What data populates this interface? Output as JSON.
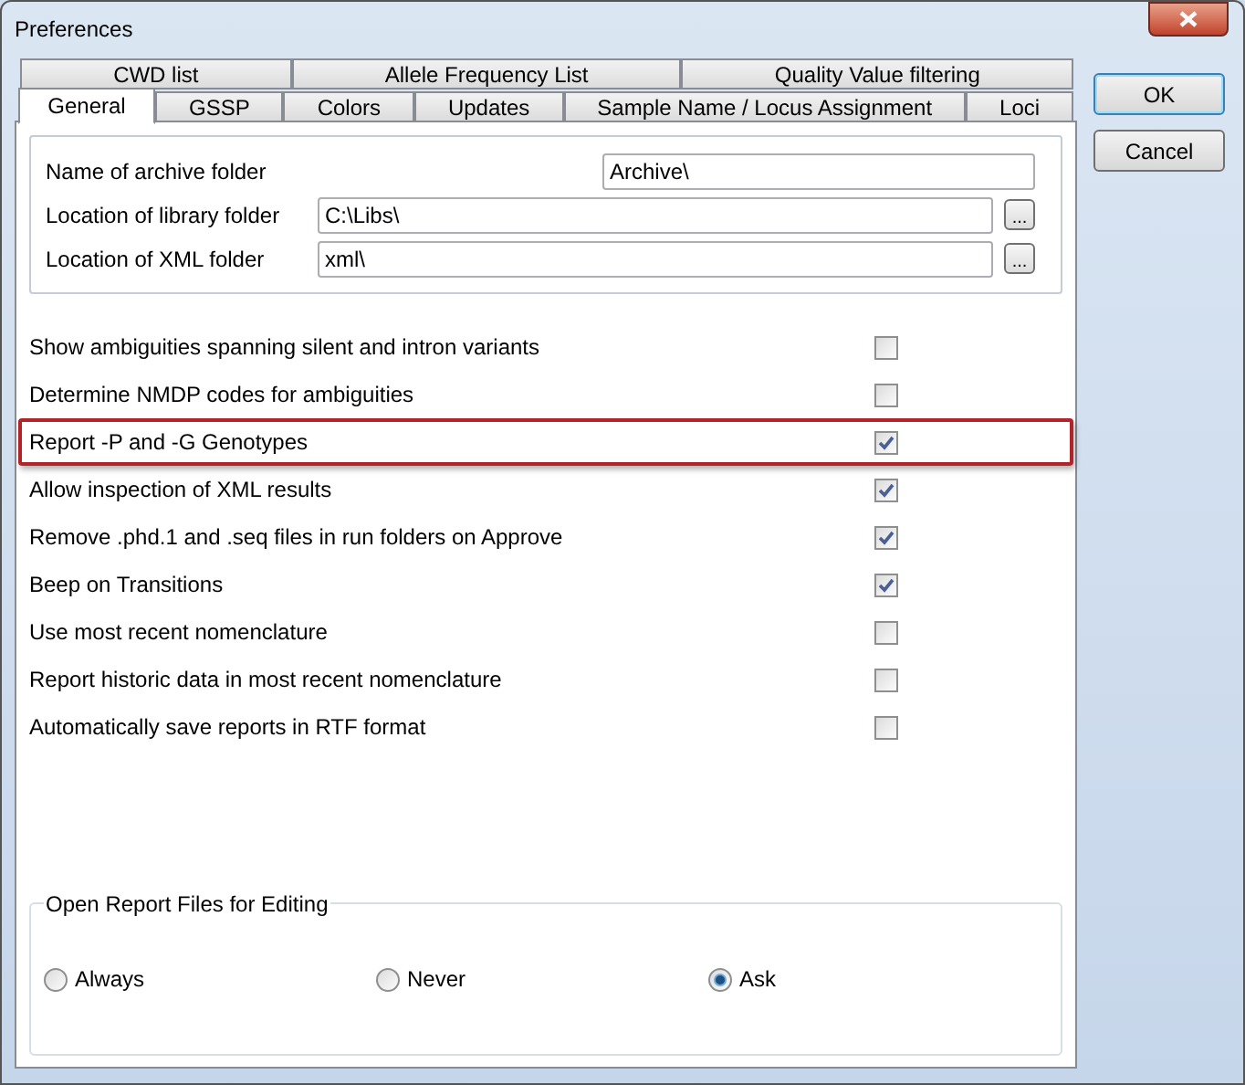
{
  "window": {
    "title": "Preferences"
  },
  "tab_rows": [
    [
      {
        "label": "CWD list",
        "selected": false
      },
      {
        "label": "Allele Frequency List",
        "selected": false
      },
      {
        "label": "Quality Value filtering",
        "selected": false
      }
    ],
    [
      {
        "label": "General",
        "selected": true
      },
      {
        "label": "GSSP",
        "selected": false
      },
      {
        "label": "Colors",
        "selected": false
      },
      {
        "label": "Updates",
        "selected": false
      },
      {
        "label": "Sample Name / Locus Assignment",
        "selected": false
      },
      {
        "label": "Loci",
        "selected": false
      }
    ]
  ],
  "folders": [
    {
      "label": "Name of archive folder",
      "value": "Archive\\"
    },
    {
      "label": "Location of library folder",
      "value": "C:\\Libs\\",
      "browse_label": "..."
    },
    {
      "label": "Location of XML folder",
      "value": "xml\\",
      "browse_label": "..."
    }
  ],
  "options": [
    {
      "label": "Show ambiguities spanning silent and intron variants",
      "checked": false,
      "highlighted": false
    },
    {
      "label": "Determine NMDP codes for ambiguities",
      "checked": false,
      "highlighted": false
    },
    {
      "label": "Report -P and -G Genotypes",
      "checked": true,
      "highlighted": true
    },
    {
      "label": "Allow inspection of XML results",
      "checked": true,
      "highlighted": false
    },
    {
      "label": "Remove .phd.1 and .seq files in run folders on Approve",
      "checked": true,
      "highlighted": false
    },
    {
      "label": "Beep on Transitions",
      "checked": true,
      "highlighted": false
    },
    {
      "label": "Use most recent nomenclature",
      "checked": false,
      "highlighted": false
    },
    {
      "label": "Report historic data in most recent nomenclature",
      "checked": false,
      "highlighted": false
    },
    {
      "label": "Automatically save reports in RTF format",
      "checked": false,
      "highlighted": false
    }
  ],
  "open_report": {
    "title": "Open Report Files for Editing",
    "choices": [
      {
        "label": "Always",
        "selected": false
      },
      {
        "label": "Never",
        "selected": false
      },
      {
        "label": "Ask",
        "selected": true
      }
    ]
  },
  "buttons": [
    "OK",
    "Cancel"
  ]
}
